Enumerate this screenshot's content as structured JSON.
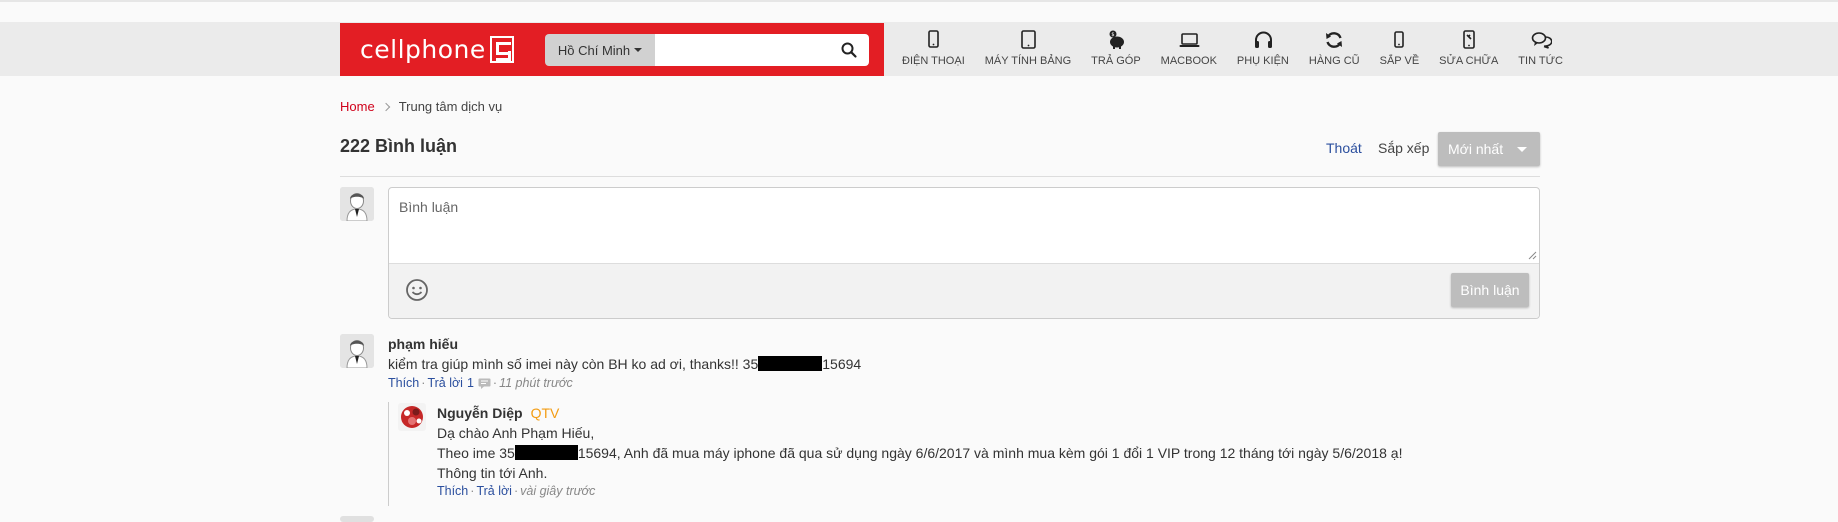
{
  "header": {
    "logo_text": "cellphone",
    "city": "Hồ Chí Minh",
    "search_placeholder": "",
    "nav": [
      {
        "label": "ĐIỆN THOẠI",
        "icon": "phone-icon"
      },
      {
        "label": "MÁY TÍNH BẢNG",
        "icon": "tablet-icon"
      },
      {
        "label": "TRẢ GÓP",
        "icon": "piggy-bank-icon"
      },
      {
        "label": "MACBOOK",
        "icon": "laptop-icon"
      },
      {
        "label": "PHỤ KIỆN",
        "icon": "headphones-icon"
      },
      {
        "label": "HÀNG CŨ",
        "icon": "refresh-icon"
      },
      {
        "label": "SẮP VỀ",
        "icon": "phone-icon"
      },
      {
        "label": "SỬA CHỮA",
        "icon": "repair-phone-icon"
      },
      {
        "label": "TIN TỨC",
        "icon": "chat-bubbles-icon"
      }
    ]
  },
  "breadcrumb": {
    "home": "Home",
    "current": "Trung tâm dịch vụ"
  },
  "comments_header": {
    "count_label": "222 Bình luận",
    "logout": "Thoát",
    "sort_label": "Sắp xếp",
    "sort_value": "Mới nhất"
  },
  "composer": {
    "placeholder": "Bình luận",
    "submit": "Bình luận"
  },
  "comments": [
    {
      "author": "phạm hiếu",
      "text_before": "kiểm tra giúp mình số imei này còn BH ko ad ơi, thanks!! 35",
      "text_after": "15694",
      "like": "Thích",
      "reply": "Trả lời",
      "reply_count": "1",
      "time": "11 phút trước",
      "replies": [
        {
          "author": "Nguyễn Diệp",
          "badge": "QTV",
          "line1": "Dạ chào Anh Phạm Hiếu,",
          "line2_before": "Theo ime 35",
          "line2_after": "15694, Anh đã mua máy iphone đã qua sử dụng ngày 6/6/2017 và mình mua kèm gói 1 đổi 1 VIP trong 12 tháng tới ngày 5/6/2018 ạ!",
          "line3": "Thông tin tới Anh.",
          "like": "Thích",
          "reply": "Trả lời",
          "time": "vài giây trước"
        }
      ]
    }
  ],
  "colors": {
    "brand_red": "#e31e24",
    "link_blue": "#2b4f9e",
    "qtv_orange": "#f39c12"
  }
}
